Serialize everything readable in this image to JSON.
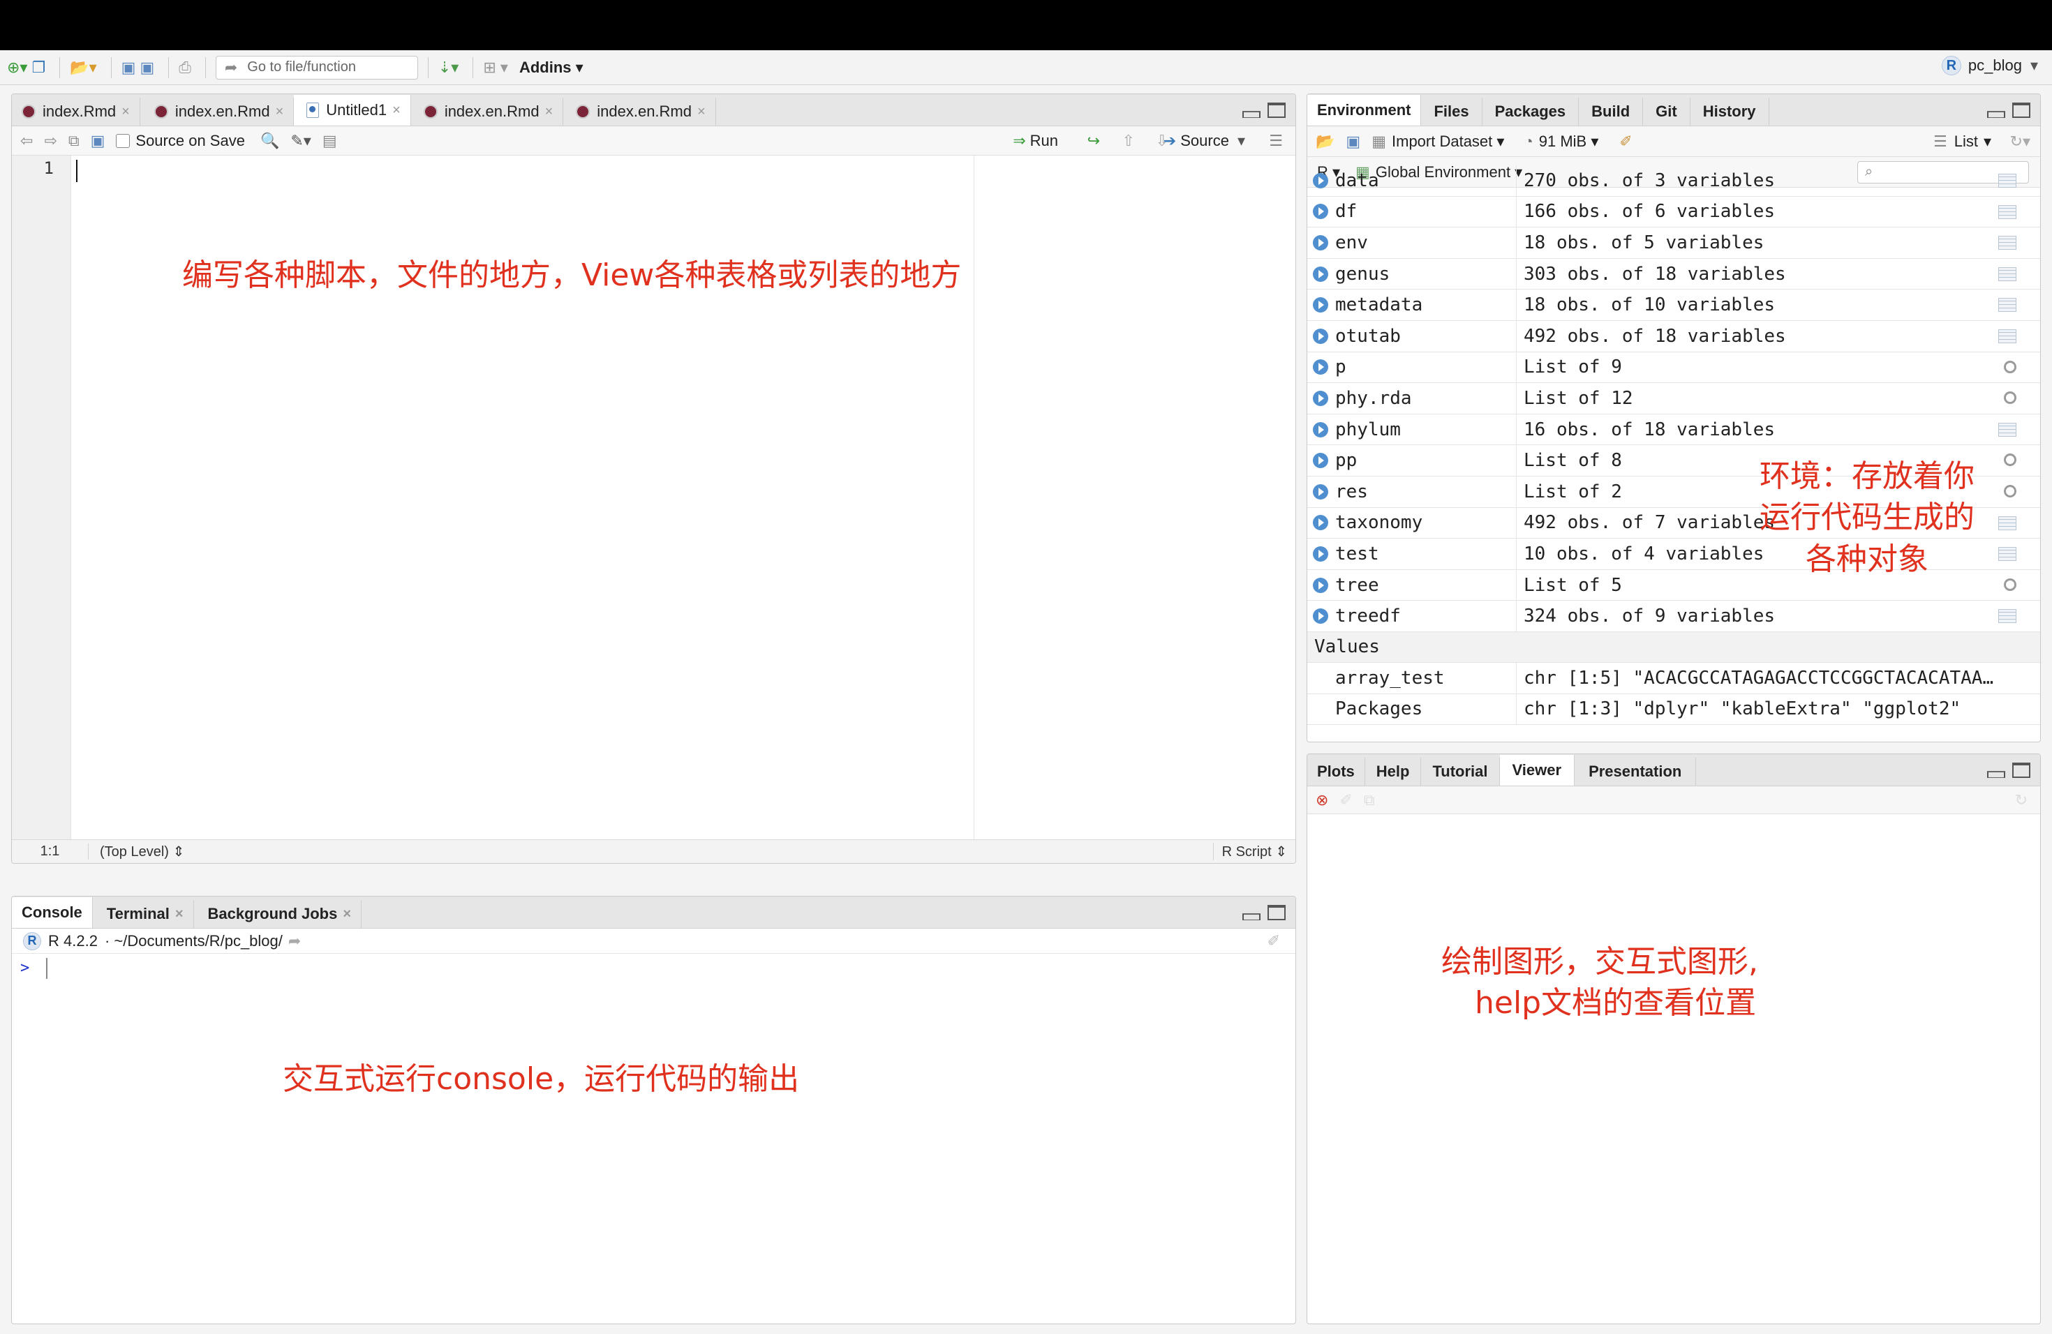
{
  "toolbar": {
    "goto_placeholder": "Go to file/function",
    "addins_label": "Addins",
    "project_label": "pc_blog"
  },
  "source_pane": {
    "tabs": [
      {
        "label": "index.Rmd"
      },
      {
        "label": "index.en.Rmd"
      },
      {
        "label": "Untitled1"
      },
      {
        "label": "index.en.Rmd"
      },
      {
        "label": "index.en.Rmd"
      }
    ],
    "source_on_save": "Source on Save",
    "run_label": "Run",
    "source_label": "Source",
    "line_number": "1",
    "status_position": "1:1",
    "status_scope": "(Top Level) ⇕",
    "status_type": "R Script ⇕",
    "annotation": "编写各种脚本，文件的地方，View各种表格或列表的地方"
  },
  "console_pane": {
    "tabs": [
      {
        "label": "Console"
      },
      {
        "label": "Terminal"
      },
      {
        "label": "Background Jobs"
      }
    ],
    "version": "R 4.2.2",
    "path": "· ~/Documents/R/pc_blog/",
    "prompt": ">",
    "annotation": "交互式运行console，运行代码的输出"
  },
  "env_pane": {
    "tabs": [
      {
        "label": "Environment"
      },
      {
        "label": "Files"
      },
      {
        "label": "Packages"
      },
      {
        "label": "Build"
      },
      {
        "label": "Git"
      },
      {
        "label": "History"
      }
    ],
    "import_label": "Import Dataset",
    "memory_label": "91 MiB",
    "list_label": "List",
    "lang_label": "R",
    "env_label": "Global Environment",
    "rows": [
      {
        "name": "data",
        "value": "270 obs. of 3 variables",
        "icon": "grid"
      },
      {
        "name": "df",
        "value": "166 obs. of 6 variables",
        "icon": "grid"
      },
      {
        "name": "env",
        "value": "18 obs. of 5 variables",
        "icon": "grid"
      },
      {
        "name": "genus",
        "value": "303 obs. of 18 variables",
        "icon": "grid"
      },
      {
        "name": "metadata",
        "value": "18 obs. of 10 variables",
        "icon": "grid"
      },
      {
        "name": "otutab",
        "value": "492 obs. of 18 variables",
        "icon": "grid"
      },
      {
        "name": "p",
        "value": "List of  9",
        "icon": "search"
      },
      {
        "name": "phy.rda",
        "value": "List of  12",
        "icon": "search"
      },
      {
        "name": "phylum",
        "value": "16 obs. of 18 variables",
        "icon": "grid"
      },
      {
        "name": "pp",
        "value": "List of  8",
        "icon": "search"
      },
      {
        "name": "res",
        "value": "List of  2",
        "icon": "search"
      },
      {
        "name": "taxonomy",
        "value": "492 obs. of 7 variables",
        "icon": "grid"
      },
      {
        "name": "test",
        "value": "10 obs. of 4 variables",
        "icon": "grid"
      },
      {
        "name": "tree",
        "value": "List of  5",
        "icon": "search"
      },
      {
        "name": "treedf",
        "value": "324 obs. of 9 variables",
        "icon": "grid"
      }
    ],
    "values_header": "Values",
    "values": [
      {
        "name": "array_test",
        "value": "chr [1:5] \"ACACGCCATAGAGACCTCCGGCTACACATAA…"
      },
      {
        "name": "Packages",
        "value": "chr [1:3] \"dplyr\" \"kableExtra\" \"ggplot2\""
      }
    ],
    "annotation_lines": [
      "环境：存放着你",
      "运行代码生成的",
      "各种对象"
    ]
  },
  "viewer_pane": {
    "tabs": [
      {
        "label": "Plots"
      },
      {
        "label": "Help"
      },
      {
        "label": "Tutorial"
      },
      {
        "label": "Viewer"
      },
      {
        "label": "Presentation"
      }
    ],
    "annotation_lines": [
      "绘制图形，交互式图形,",
      "help文档的查看位置"
    ]
  },
  "colors": {
    "annotation": "#e0301e",
    "prompt": "#1b2fcf",
    "rmd_icon": "#7b2438"
  }
}
